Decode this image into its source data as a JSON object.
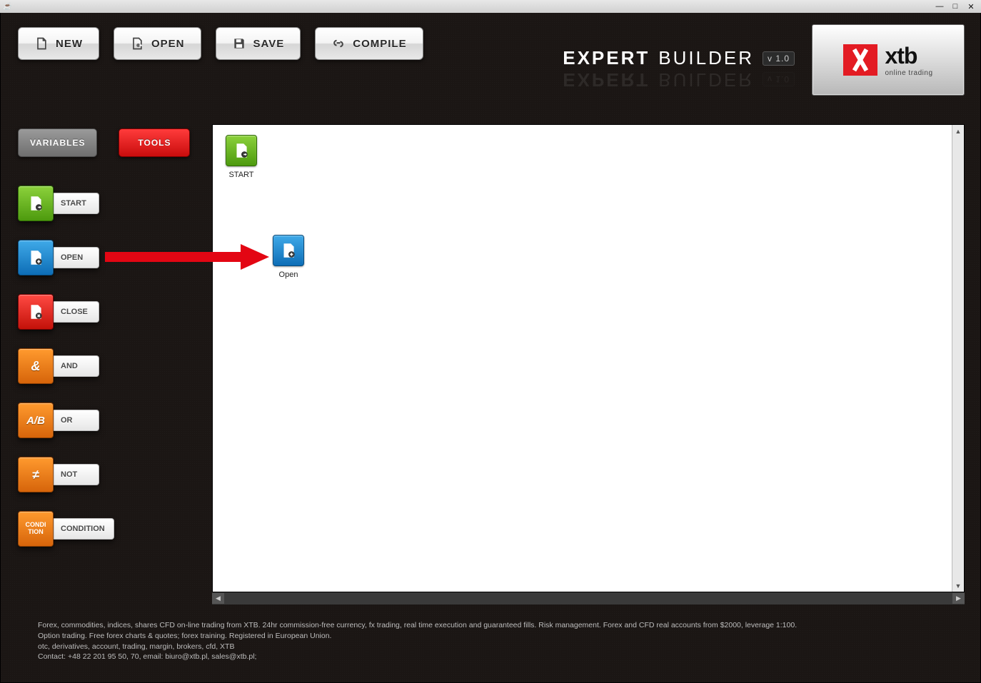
{
  "window": {
    "minimize": "—",
    "maximize": "□",
    "close": "✕"
  },
  "toolbar": {
    "new": "NEW",
    "open": "OPEN",
    "save": "SAVE",
    "compile": "COMPILE"
  },
  "branding": {
    "bold": "EXPERT",
    "light": "BUILDER",
    "version": "v 1.0"
  },
  "logo": {
    "name": "xtb",
    "tagline": "online trading"
  },
  "tabs": {
    "variables": "VARIABLES",
    "tools": "TOOLS"
  },
  "tools": {
    "start": "START",
    "open": "OPEN",
    "close": "CLOSE",
    "and": "AND",
    "or": "OR",
    "not": "NOT",
    "condition": "CONDITION",
    "and_sym": "&",
    "or_sym": "A/B",
    "not_sym": "≠",
    "cond_sym1": "CONDI",
    "cond_sym2": "TION"
  },
  "canvas": {
    "start_label": "START",
    "open_label": "Open"
  },
  "footer": {
    "l1": "Forex, commodities, indices, shares CFD on-line trading from XTB. 24hr commission-free currency, fx trading, real time execution and guaranteed fills. Risk management. Forex and CFD real accounts from $2000, leverage 1:100.",
    "l2": "Option trading. Free forex charts & quotes; forex training. Registered in European Union.",
    "l3": "otc, derivatives, account, trading, margin, brokers, cfd, XTB",
    "l4": "Contact: +48 22 201 95 50, 70, email: biuro@xtb.pl, sales@xtb.pl;"
  }
}
